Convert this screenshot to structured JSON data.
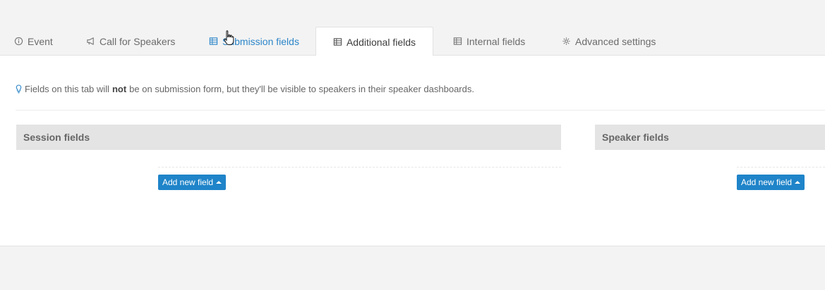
{
  "tabs": [
    {
      "label": "Event",
      "icon": "info-circle-icon"
    },
    {
      "label": "Call for Speakers",
      "icon": "megaphone-icon"
    },
    {
      "label": "Submission fields",
      "icon": "table-icon"
    },
    {
      "label": "Additional fields",
      "icon": "table-icon"
    },
    {
      "label": "Internal fields",
      "icon": "table-icon"
    },
    {
      "label": "Advanced settings",
      "icon": "gear-icon"
    }
  ],
  "info": {
    "prefix": "Fields on this tab will",
    "emphasis": "not",
    "suffix": "be on submission form, but they'll be visible to speakers in their speaker dashboards."
  },
  "sections": {
    "session": {
      "title": "Session fields",
      "button": "Add new field"
    },
    "speaker": {
      "title": "Speaker fields",
      "button": "Add new field"
    }
  },
  "colors": {
    "accent": "#1f84c9",
    "hover_tab": "#2d86c9",
    "section_header": "#e4e4e4"
  }
}
